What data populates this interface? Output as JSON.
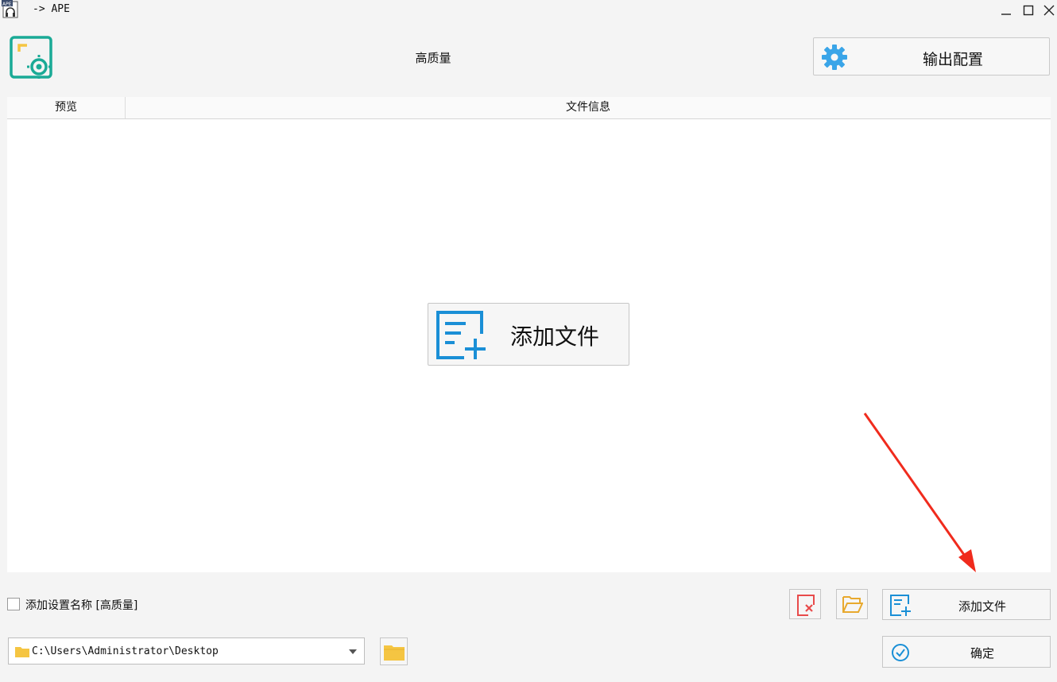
{
  "window": {
    "title": "-> APE",
    "app_icon_text": "APE",
    "minimize_icon": "minimize-icon",
    "maximize_icon": "maximize-icon",
    "close_icon": "close-icon"
  },
  "header": {
    "preset_name": "高质量",
    "output_config_label": "输出配置",
    "logo_icon": "app-logo-icon",
    "gear_icon": "gear-icon"
  },
  "file_list": {
    "columns": [
      "预览",
      "文件信息"
    ],
    "add_file_big_label": "添加文件",
    "add_file_icon": "add-file-icon"
  },
  "bottom": {
    "checkbox_label": "添加设置名称 [高质量]",
    "checkbox_checked": false,
    "output_path": "C:\\Users\\Administrator\\Desktop",
    "add_file_label": "添加文件",
    "confirm_label": "确定",
    "clear_icon": "clear-list-icon",
    "open_folder_icon": "open-folder-icon",
    "confirm_icon": "check-circle-icon"
  },
  "colors": {
    "accent_teal": "#1aaa96",
    "accent_yellow": "#f5c542",
    "accent_blue": "#1a8fd6",
    "gear_blue": "#3aa5e8",
    "annotation_red": "#f02b1d",
    "folder_yellow": "#f5c542"
  }
}
